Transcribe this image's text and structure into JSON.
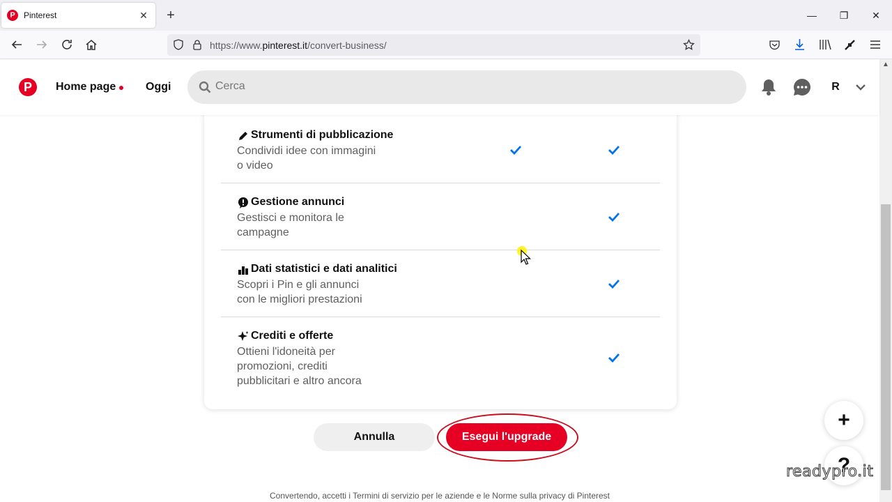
{
  "browser": {
    "tab_title": "Pinterest",
    "url_prefix": "https://www.",
    "url_host": "pinterest.it",
    "url_path": "/convert-business/"
  },
  "header": {
    "home_label": "Home page",
    "today_label": "Oggi",
    "search_placeholder": "Cerca",
    "avatar_initial": "R"
  },
  "features": [
    {
      "title": "Strumenti di pubblicazione",
      "desc": "Condividi idee con immagini o video",
      "icon": "pencil-icon",
      "personal": true,
      "business": true
    },
    {
      "title": "Gestione annunci",
      "desc": "Gestisci e monitora le campagne",
      "icon": "megaphone-icon",
      "personal": false,
      "business": true
    },
    {
      "title": "Dati statistici e dati analitici",
      "desc": "Scopri i Pin e gli annunci con le migliori prestazioni",
      "icon": "chart-icon",
      "personal": false,
      "business": true
    },
    {
      "title": "Crediti e offerte",
      "desc": "Ottieni l'idoneità per promozioni, crediti pubblicitari e altro ancora",
      "icon": "sparkle-icon",
      "personal": false,
      "business": true
    }
  ],
  "actions": {
    "cancel_label": "Annulla",
    "upgrade_label": "Esegui l'upgrade"
  },
  "footer_note": "Convertendo, accetti i Termini di servizio per le aziende e le Norme sulla privacy di Pinterest",
  "fab": {
    "add": "+",
    "help": "?"
  },
  "watermark": "readypro.it",
  "colors": {
    "brand": "#e60023",
    "check": "#0074e8"
  }
}
